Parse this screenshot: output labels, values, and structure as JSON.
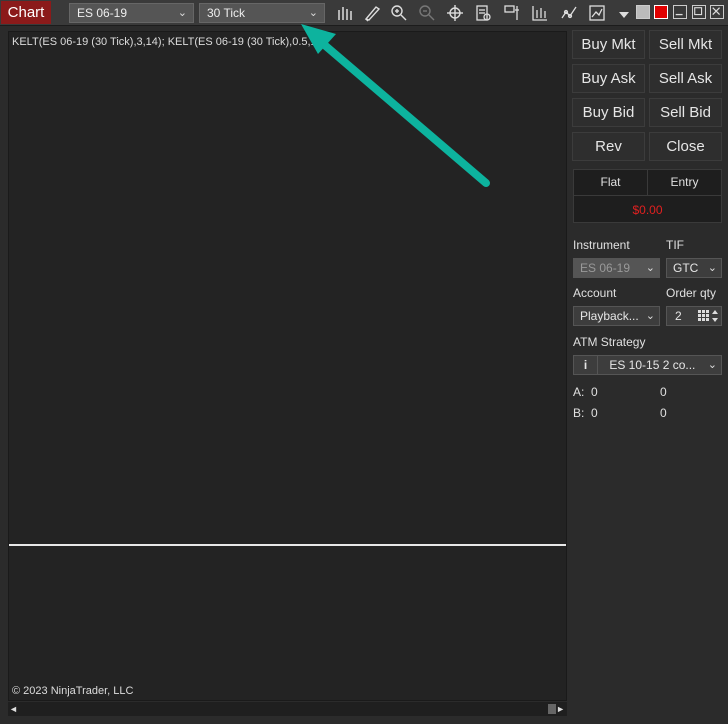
{
  "toolbar": {
    "chart_label": "Chart",
    "instrument": "ES 06-19",
    "period": "30 Tick",
    "chevron": "⌄",
    "icons": [
      "bar-type-icon",
      "drawing-tool-icon",
      "zoom-in-icon",
      "zoom-out-icon",
      "crosshair-icon",
      "properties-icon",
      "data-box-icon",
      "strategies-icon",
      "indicators-icon",
      "templates-icon",
      "more-menu-icon"
    ],
    "window_controls": [
      "link-color-icon",
      "minimize-icon",
      "maximize-icon",
      "close-icon"
    ]
  },
  "chart": {
    "indicator_label": "KELT(ES 06-19 (30 Tick),3,14); KELT(ES 06-19 (30 Tick),0.5,14)",
    "copyright": "© 2023 NinjaTrader, LLC"
  },
  "scrollbar": {
    "left": "◄",
    "right": "►"
  },
  "trader": {
    "buttons": {
      "buy_mkt": "Buy Mkt",
      "sell_mkt": "Sell Mkt",
      "buy_ask": "Buy Ask",
      "sell_ask": "Sell Ask",
      "buy_bid": "Buy Bid",
      "sell_bid": "Sell Bid",
      "rev": "Rev",
      "close": "Close"
    },
    "position": {
      "flat": "Flat",
      "entry": "Entry",
      "pnl": "$0.00"
    },
    "instrument_label": "Instrument",
    "instrument_value": "ES 06-19",
    "tif_label": "TIF",
    "tif_value": "GTC",
    "account_label": "Account",
    "account_value": "Playback...",
    "qty_label": "Order qty",
    "qty_value": "2",
    "atm_label": "ATM Strategy",
    "atm_info": "i",
    "atm_value": "ES 10-15 2 co...",
    "a_label": "A:",
    "a_value1": "0",
    "a_value2": "0",
    "b_label": "B:",
    "b_value1": "0",
    "b_value2": "0"
  },
  "colors": {
    "chart_label_bg": "#8b1a1a",
    "arrow": "#0db39e",
    "pnl": "#e02020"
  }
}
